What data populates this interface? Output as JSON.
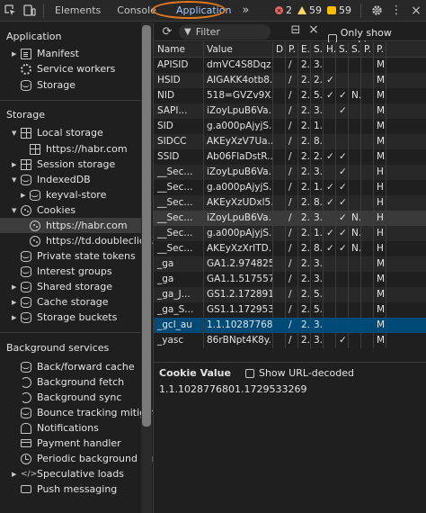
{
  "toolbar": {
    "tabs": [
      "Elements",
      "Console",
      "Application"
    ],
    "more": "»",
    "errors": "2",
    "warnings": "59",
    "issues": "59"
  },
  "sidebar": {
    "application_header": "Application",
    "application_items": [
      "Manifest",
      "Service workers",
      "Storage"
    ],
    "storage_header": "Storage",
    "storage_items": [
      "Local storage",
      "https://habr.com",
      "Session storage",
      "IndexedDB",
      "keyval-store",
      "Cookies",
      "https://habr.com",
      "https://td.doubleclick.n",
      "Private state tokens",
      "Interest groups",
      "Shared storage",
      "Cache storage",
      "Storage buckets"
    ],
    "background_header": "Background services",
    "background_items": [
      "Back/forward cache",
      "Background fetch",
      "Background sync",
      "Bounce tracking mitigatic",
      "Notifications",
      "Payment handler",
      "Periodic background sync",
      "Speculative loads",
      "Push messaging"
    ]
  },
  "filterbar": {
    "placeholder": "Filter",
    "only_show": "Only show cooki..."
  },
  "table": {
    "headers": [
      "Name",
      "Value",
      "D",
      "P.",
      "E.",
      "S.",
      "H.",
      "S.",
      "S.",
      "P.",
      "P."
    ],
    "rows": [
      [
        "APISID",
        "dmVC4S8Dqz...",
        "",
        "/",
        "2.",
        "3.",
        "",
        "",
        "",
        "",
        "M"
      ],
      [
        "HSID",
        "AIGAKK4otb8...",
        "",
        "/",
        "2.",
        "2.",
        "✓",
        "",
        "",
        "",
        "M"
      ],
      [
        "NID",
        "518=GVZv9X...",
        "",
        "/",
        "2.",
        "5.",
        "✓",
        "✓",
        "N..",
        "",
        "M"
      ],
      [
        "SAPI...",
        "iZoyLpuB6Va...",
        "",
        "/",
        "2.",
        "3.",
        "",
        "✓",
        "",
        "",
        "M"
      ],
      [
        "SID",
        "g.a000pAjyjS...",
        "",
        "/",
        "2.",
        "1.",
        "",
        "",
        "",
        "",
        "M"
      ],
      [
        "SIDCC",
        "AKEyXzV7Ua...",
        "",
        "/",
        "2.",
        "8.",
        "",
        "",
        "",
        "",
        "M"
      ],
      [
        "SSID",
        "Ab06FlaDstR...",
        "",
        "/",
        "2.",
        "2.",
        "✓",
        "✓",
        "",
        "",
        "M"
      ],
      [
        "__Sec...",
        "iZoyLpuB6Va...",
        "",
        "/",
        "2.",
        "3.",
        "",
        "✓",
        "",
        "",
        "H"
      ],
      [
        "__Sec...",
        "g.a000pAjyjS...",
        "",
        "/",
        "2.",
        "1.",
        "✓",
        "✓",
        "",
        "",
        "H"
      ],
      [
        "__Sec...",
        "AKEyXzUDxl5...",
        "",
        "/",
        "2.",
        "8.",
        "✓",
        "✓",
        "",
        "",
        "H"
      ],
      [
        "__Sec...",
        "iZoyLpuB6Va...",
        "",
        "/",
        "2.",
        "3.",
        "",
        "✓",
        "N..",
        "",
        "H"
      ],
      [
        "__Sec...",
        "g.a000pAjyjS...",
        "",
        "/",
        "2.",
        "1.",
        "✓",
        "✓",
        "N..",
        "",
        "H"
      ],
      [
        "__Sec...",
        "AKEyXzXrITD...",
        "",
        "/",
        "2.",
        "8.",
        "✓",
        "✓",
        "N..",
        "",
        "H"
      ],
      [
        "_ga",
        "GA1.2.974825...",
        "",
        "/",
        "2.",
        "3.",
        "",
        "",
        "",
        "",
        "M"
      ],
      [
        "_ga",
        "GA1.1.517557...",
        "",
        "/",
        "2.",
        "3.",
        "",
        "",
        "",
        "",
        "M"
      ],
      [
        "_ga_J...",
        "GS1.2.172891...",
        "",
        "/",
        "2.",
        "5.",
        "",
        "",
        "",
        "",
        "M"
      ],
      [
        "_ga_S...",
        "GS1.1.172953...",
        "",
        "/",
        "2.",
        "5.",
        "",
        "",
        "",
        "",
        "M"
      ],
      [
        "_gcl_au",
        "1.1.10287768...",
        "",
        "/",
        "2.",
        "3.",
        "",
        "",
        "",
        "",
        "M"
      ],
      [
        "_yasc",
        "86rBNpt4K8y...",
        "",
        "/",
        "2.",
        "3.",
        "",
        "✓",
        "",
        "",
        "M"
      ]
    ]
  },
  "value_panel": {
    "title": "Cookie Value",
    "show_decoded": "Show URL-decoded",
    "value": "1.1.1028776801.1729533269"
  },
  "colors": {
    "accent": "#a8c7fa",
    "highlight_ellipse": "#e37a1e",
    "selected_row": "#004a77"
  }
}
